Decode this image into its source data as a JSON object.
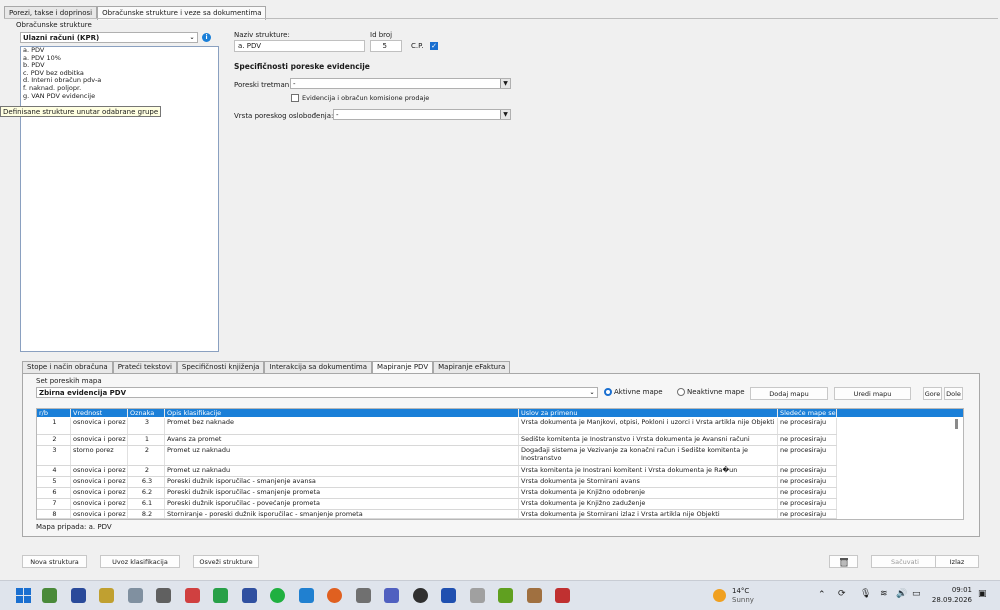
{
  "tabs_top": [
    {
      "label": "Porezi, takse i doprinosi",
      "active": false
    },
    {
      "label": "Obračunske strukture i veze sa dokumentima",
      "active": true
    }
  ],
  "left": {
    "group_label": "Obračunske strukture",
    "combo_value": "Ulazni računi (KPR)",
    "info_icon": "info-icon",
    "items": [
      "a. PDV",
      "a. PDV 10%",
      "b. PDV",
      "c. PDV bez odbitka",
      "d. Interni obračun pdv-a",
      "f. naknad. poljopr.",
      "g. VAN PDV evidencije"
    ],
    "tooltip": "Definisane strukture unutar odabrane grupe"
  },
  "right": {
    "naziv_label": "Naziv strukture:",
    "naziv_value": "a. PDV",
    "id_label": "Id broj",
    "id_value": "5",
    "cp_label": "C.P.",
    "cp_checked": true,
    "section_title": "Specifičnosti poreske evidencije",
    "poreski_tretman_label": "Poreski tretman",
    "poreski_tretman_value": "-",
    "evidencija_label": "Evidencija i obračun komisione prodaje",
    "vrsta_label": "Vrsta poreskog oslobođenja:",
    "vrsta_value": "-"
  },
  "tabs_bottom": [
    {
      "label": "Stope i način obračuna",
      "active": false
    },
    {
      "label": "Prateći tekstovi",
      "active": false
    },
    {
      "label": "Specifičnosti knjiženja",
      "active": false
    },
    {
      "label": "Interakcija sa dokumentima",
      "active": false
    },
    {
      "label": "Mapiranje PDV",
      "active": true
    },
    {
      "label": "Mapiranje eFaktura",
      "active": false
    }
  ],
  "mapping": {
    "set_label": "Set poreskih mapa",
    "set_value": "Zbirna evidencija PDV",
    "radio_active": "Aktivne mape",
    "radio_inactive": "Neaktivne mape",
    "btn_add": "Dodaj mapu",
    "btn_edit": "Uredi mapu",
    "btn_up": "Gore",
    "btn_down": "Dole",
    "columns": [
      "r/b",
      "Vrednost",
      "Oznaka",
      "Opis klasifikacije",
      "Uslov za primenu",
      "Sledeće mape se"
    ],
    "rows": [
      {
        "rb": "1",
        "vrednost": "osnovica i porez",
        "oznaka": "3",
        "opis": "Promet bez naknade",
        "uslov": "Vrsta dokumenta je Manjkovi, otpisi, Pokloni i uzorci i Vrsta artikla nije Objekti",
        "sledece": "ne procesiraju",
        "h": 17
      },
      {
        "rb": "2",
        "vrednost": "osnovica i porez",
        "oznaka": "1",
        "opis": "Avans za promet",
        "uslov": "Sedište komitenta je Inostranstvo i Vrsta dokumenta je Avansni računi",
        "sledece": "ne procesiraju",
        "h": 11
      },
      {
        "rb": "3",
        "vrednost": "storno porez",
        "oznaka": "2",
        "opis": "Promet uz naknadu",
        "uslov": "Događaji sistema je Vezivanje za konačni račun i Sedište komitenta je Inostranstvo",
        "sledece": "ne procesiraju",
        "h": 20
      },
      {
        "rb": "4",
        "vrednost": "osnovica i porez",
        "oznaka": "2",
        "opis": "Promet uz naknadu",
        "uslov": "Vrsta komitenta je Inostrani komitent i Vrsta dokumenta je Ra�un",
        "sledece": "ne procesiraju",
        "h": 11
      },
      {
        "rb": "5",
        "vrednost": "osnovica i porez",
        "oznaka": "6.3",
        "opis": "Poreski dužnik isporučilac - smanjenje avansa",
        "uslov": "Vrsta dokumenta je Stornirani avans",
        "sledece": "ne procesiraju",
        "h": 11
      },
      {
        "rb": "6",
        "vrednost": "osnovica i porez",
        "oznaka": "6.2",
        "opis": "Poreski dužnik isporučilac - smanjenje prometa",
        "uslov": "Vrsta dokumenta je Knjižno odobrenje",
        "sledece": "ne procesiraju",
        "h": 11
      },
      {
        "rb": "7",
        "vrednost": "osnovica i porez",
        "oznaka": "6.1",
        "opis": "Poreski dužnik isporučilac - povećanje prometa",
        "uslov": "Vrsta dokumenta je Knjižno zaduženje",
        "sledece": "ne procesiraju",
        "h": 11
      },
      {
        "rb": "8",
        "vrednost": "osnovica i porez",
        "oznaka": "8.2",
        "opis": "Storniranje - poreski dužnik isporučilac - smanjenje prometa",
        "uslov": "Vrsta dokumenta je Stornirani izlaz i Vrsta artikla nije Objekti",
        "sledece": "ne procesiraju",
        "h": 9
      }
    ],
    "footer": "Mapa pripada: a. PDV"
  },
  "bottom_buttons": {
    "nova": "Nova struktura",
    "uvoz": "Uvoz klasifikacija",
    "osvezi": "Osveži strukture",
    "sacuvati": "Sačuvati",
    "izlaz": "Izlaz",
    "delete_icon": "trash-icon"
  },
  "taskbar": {
    "weather_temp": "14°C",
    "weather_desc": "Sunny",
    "time": "09:01",
    "date": "28.09.2026"
  }
}
